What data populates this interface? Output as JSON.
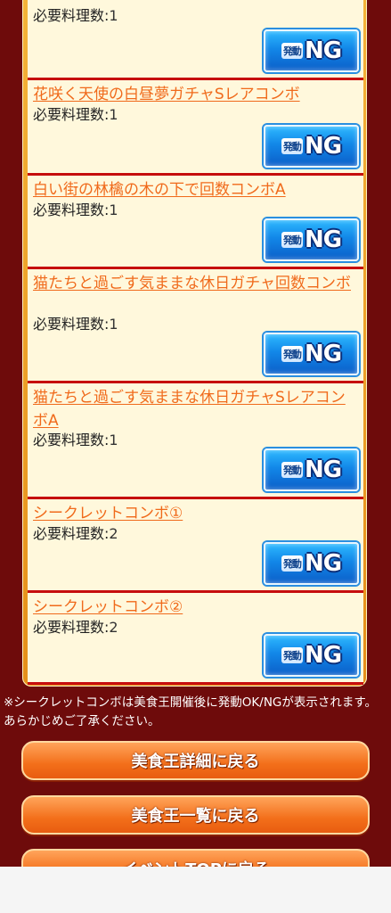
{
  "combos": [
    {
      "title": "",
      "req_label": "必要料理数:",
      "req_value": "1",
      "status": "NG"
    },
    {
      "title": "花咲く天使の白昼夢ガチャSレアコンボ",
      "req_label": "必要料理数:",
      "req_value": "1",
      "status": "NG"
    },
    {
      "title": "白い街の林檎の木の下で回数コンボA",
      "req_label": "必要料理数:",
      "req_value": "1",
      "status": "NG"
    },
    {
      "title": "猫たちと過ごす気ままな休日ガチャ回数コンボ",
      "req_label": "必要料理数:",
      "req_value": "1",
      "status": "NG"
    },
    {
      "title": "猫たちと過ごす気ままな休日ガチャSレアコンボA",
      "req_label": "必要料理数:",
      "req_value": "1",
      "status": "NG"
    },
    {
      "title": "シークレットコンボ①",
      "req_label": "必要料理数:",
      "req_value": "2",
      "status": "NG"
    },
    {
      "title": "シークレットコンボ②",
      "req_label": "必要料理数:",
      "req_value": "2",
      "status": "NG"
    }
  ],
  "badge": {
    "trigger_label": "発動",
    "ng_label": "NG"
  },
  "note": "※シークレットコンボは美食王開催後に発動OK/NGが表示されます。あらかじめご了承ください。",
  "buttons": {
    "back_detail": "美食王詳細に戻る",
    "back_list": "美食王一覧に戻る",
    "back_event_top": "イベントTOPに戻る"
  },
  "colors": {
    "background": "#6e0b0b",
    "panel_border": "#f4b43a",
    "item_bg": "#fff8dc",
    "title_link": "#f06a1b",
    "badge_blue": "#1287e8",
    "button_orange": "#f36f1a"
  }
}
